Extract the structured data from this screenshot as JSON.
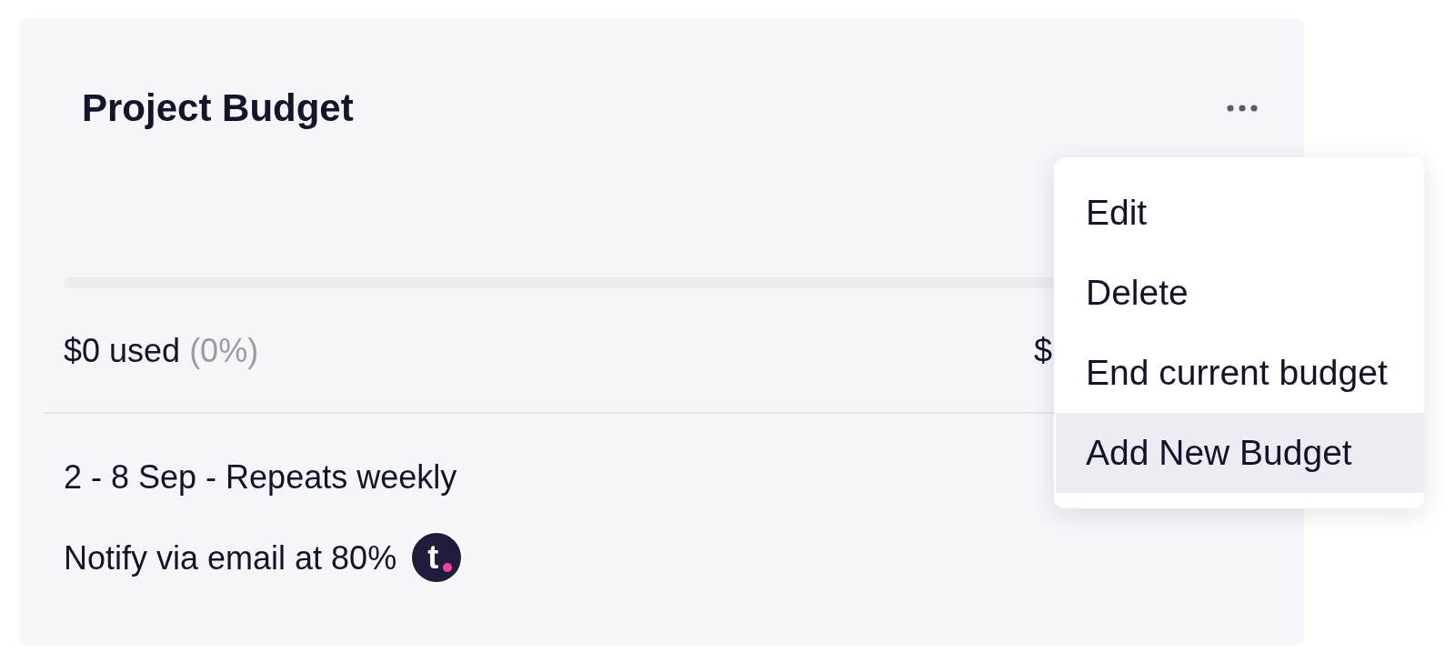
{
  "card": {
    "title": "Project Budget",
    "budget": {
      "level": 0,
      "used": "$0 used",
      "percent": "(0%)",
      "total": "$"
    },
    "schedule": "2 - 8 Sep - Repeats weekly",
    "notification": {
      "text": "Notify via email at 80%",
      "avatar": "t"
    }
  },
  "menu": {
    "items": [
      {
        "label": "Edit",
        "selected": false
      },
      {
        "label": "Delete",
        "selected": false
      },
      {
        "label": "End current budget",
        "selected": false
      },
      {
        "label": "Add New Budget",
        "selected": true
      }
    ]
  }
}
